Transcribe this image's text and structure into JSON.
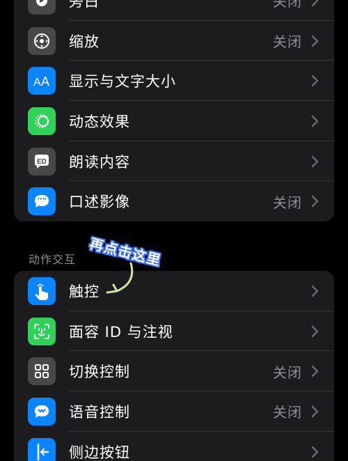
{
  "colors": {
    "background": "#000000",
    "group_bg": "#1c1c1e",
    "separator": "#38383a",
    "secondary_text": "#8e8e93",
    "accent_blue": "#0a84ff",
    "accent_green": "#30d158",
    "icon_gray": "#48484a",
    "annotation_stroke": "#3b6ff2",
    "annotation_arrow": "#c8e6a0"
  },
  "vision_group": {
    "items": [
      {
        "label": "旁白",
        "value": "关闭",
        "icon": "voiceover-icon",
        "icon_color": "#48484a"
      },
      {
        "label": "缩放",
        "value": "关闭",
        "icon": "zoom-icon",
        "icon_color": "#48484a"
      },
      {
        "label": "显示与文字大小",
        "value": "",
        "icon": "text-size-icon",
        "icon_color": "#0a84ff"
      },
      {
        "label": "动态效果",
        "value": "",
        "icon": "motion-icon",
        "icon_color": "#30d158"
      },
      {
        "label": "朗读内容",
        "value": "",
        "icon": "spoken-content-icon",
        "icon_color": "#48484a"
      },
      {
        "label": "口述影像",
        "value": "关闭",
        "icon": "audio-description-icon",
        "icon_color": "#0a84ff"
      }
    ]
  },
  "interaction_group": {
    "header": "动作交互",
    "items": [
      {
        "label": "触控",
        "value": "",
        "icon": "touch-icon",
        "icon_color": "#0a84ff"
      },
      {
        "label": "面容 ID 与注视",
        "value": "",
        "icon": "face-id-icon",
        "icon_color": "#30d158"
      },
      {
        "label": "切换控制",
        "value": "关闭",
        "icon": "switch-control-icon",
        "icon_color": "#48484a"
      },
      {
        "label": "语音控制",
        "value": "关闭",
        "icon": "voice-control-icon",
        "icon_color": "#0a84ff"
      },
      {
        "label": "侧边按钮",
        "value": "",
        "icon": "side-button-icon",
        "icon_color": "#0a84ff"
      }
    ]
  },
  "annotation": {
    "text": "再点击这里"
  }
}
